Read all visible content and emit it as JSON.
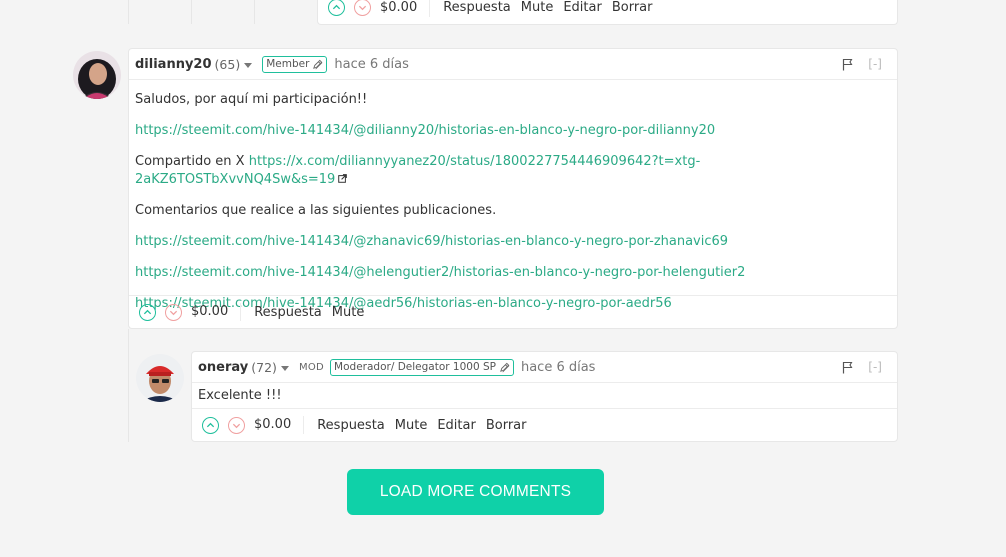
{
  "top_comment": {
    "payout": "$0.00",
    "actions": [
      "Respuesta",
      "Mute",
      "Editar",
      "Borrar"
    ]
  },
  "comment1": {
    "author": "dilianny20",
    "reputation": "(65)",
    "badge": "Member",
    "time": "hace 6 días",
    "collapse": "[-]",
    "lines": {
      "greeting": "Saludos, por aquí mi participación!!",
      "link1": "https://steemit.com/hive-141434/@dilianny20/historias-en-blanco-y-negro-por-dilianny20",
      "shared_prefix": "Compartido en X",
      "shared_link": "https://x.com/diliannyyanez20/status/1800227754446909642?t=xtg-2aKZ6TOSTbXvvNQ4Sw&s=19",
      "comments_intro": "Comentarios que realice a las siguientes publicaciones.",
      "link2": "https://steemit.com/hive-141434/@zhanavic69/historias-en-blanco-y-negro-por-zhanavic69",
      "link3": "https://steemit.com/hive-141434/@helengutier2/historias-en-blanco-y-negro-por-helengutier2",
      "link4": "https://steemit.com/hive-141434/@aedr56/historias-en-blanco-y-negro-por-aedr56"
    },
    "payout": "$0.00",
    "actions": [
      "Respuesta",
      "Mute"
    ]
  },
  "comment2": {
    "author": "oneray",
    "reputation": "(72)",
    "mod_label": "MOD",
    "badge": "Moderador/ Delegator 1000 SP",
    "time": "hace 6 días",
    "collapse": "[-]",
    "text": "Excelente !!!",
    "payout": "$0.00",
    "actions": [
      "Respuesta",
      "Mute",
      "Editar",
      "Borrar"
    ]
  },
  "load_more_label": "LOAD MORE COMMENTS",
  "colors": {
    "accent": "#0fd1a8",
    "link": "#2baa86",
    "upvote": "#1fbf9c",
    "downvote": "#f0a0a0"
  },
  "icons": [
    "upvote-icon",
    "downvote-icon",
    "flag-icon",
    "pencil-icon",
    "external-link-icon",
    "caret-down-icon"
  ]
}
